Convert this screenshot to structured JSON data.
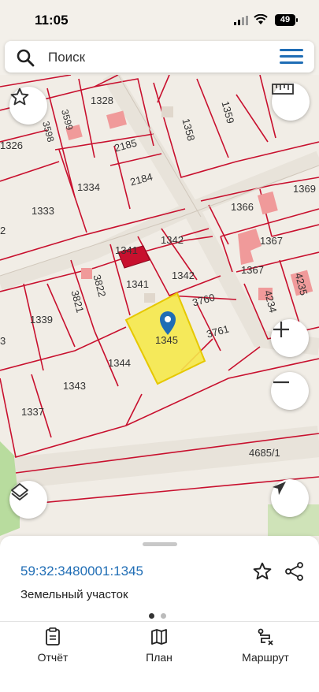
{
  "status_bar": {
    "time": "11:05",
    "battery": "49"
  },
  "search": {
    "placeholder": "Поиск"
  },
  "map": {
    "parcels": [
      "1328",
      "3599",
      "3598",
      "1326",
      "2185",
      "1358",
      "1359",
      "1334",
      "2184",
      "1333",
      "1366",
      "1369",
      "2",
      "1341",
      "1342",
      "1367",
      "1341",
      "1342",
      "1367",
      "4235",
      "3822",
      "3821",
      "3760",
      "4234",
      "1339",
      "1345",
      "3761",
      "3",
      "1344",
      "1343",
      "1337",
      "4685/1"
    ],
    "highlight_color": "#f5e84a"
  },
  "sheet": {
    "cadastral_number": "59:32:3480001:1345",
    "parcel_type": "Земельный участок"
  },
  "tabs": [
    {
      "label": "Отчёт",
      "icon": "report-icon"
    },
    {
      "label": "План",
      "icon": "map-plan-icon"
    },
    {
      "label": "Маршрут",
      "icon": "route-icon"
    }
  ],
  "colors": {
    "accent": "#1f6db5",
    "parcel_border": "#c8102e",
    "building": "#d43a3a"
  }
}
